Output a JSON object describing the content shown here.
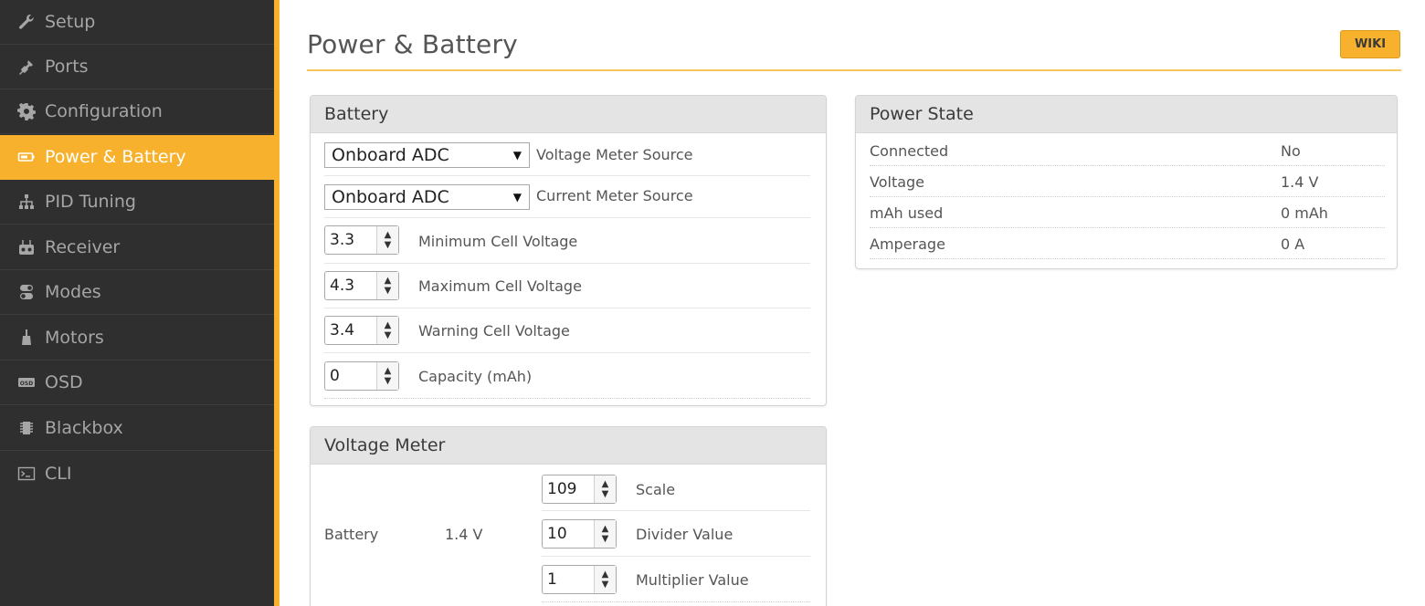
{
  "sidebar": {
    "items": [
      {
        "label": "Setup",
        "icon": "wrench-icon",
        "active": false
      },
      {
        "label": "Ports",
        "icon": "plug-icon",
        "active": false
      },
      {
        "label": "Configuration",
        "icon": "gear-icon",
        "active": false
      },
      {
        "label": "Power & Battery",
        "icon": "battery-icon",
        "active": true
      },
      {
        "label": "PID Tuning",
        "icon": "sitemap-icon",
        "active": false
      },
      {
        "label": "Receiver",
        "icon": "remote-icon",
        "active": false
      },
      {
        "label": "Modes",
        "icon": "toggle-icon",
        "active": false
      },
      {
        "label": "Motors",
        "icon": "motor-icon",
        "active": false
      },
      {
        "label": "OSD",
        "icon": "osd-icon",
        "active": false
      },
      {
        "label": "Blackbox",
        "icon": "chip-icon",
        "active": false
      },
      {
        "label": "CLI",
        "icon": "terminal-icon",
        "active": false
      }
    ]
  },
  "header": {
    "title": "Power & Battery",
    "wiki_label": "WIKI"
  },
  "battery": {
    "title": "Battery",
    "voltage_source": {
      "value": "Onboard ADC",
      "label": "Voltage Meter Source"
    },
    "current_source": {
      "value": "Onboard ADC",
      "label": "Current Meter Source"
    },
    "min_cell": {
      "value": "3.3",
      "label": "Minimum Cell Voltage"
    },
    "max_cell": {
      "value": "4.3",
      "label": "Maximum Cell Voltage"
    },
    "warn_cell": {
      "value": "3.4",
      "label": "Warning Cell Voltage"
    },
    "capacity": {
      "value": "0",
      "label": "Capacity (mAh)"
    }
  },
  "voltage_meter": {
    "title": "Voltage Meter",
    "source_name": "Battery",
    "source_value": "1.4 V",
    "scale": {
      "value": "109",
      "label": "Scale"
    },
    "divider": {
      "value": "10",
      "label": "Divider Value"
    },
    "multiplier": {
      "value": "1",
      "label": "Multiplier Value"
    }
  },
  "power_state": {
    "title": "Power State",
    "rows": [
      {
        "key": "Connected",
        "value": "No"
      },
      {
        "key": "Voltage",
        "value": "1.4 V"
      },
      {
        "key": "mAh used",
        "value": "0 mAh"
      },
      {
        "key": "Amperage",
        "value": "0 A"
      }
    ]
  },
  "colors": {
    "accent": "#f8b12c",
    "sidebar_bg": "#2f2f2f",
    "panel_head": "#e4e4e4"
  }
}
